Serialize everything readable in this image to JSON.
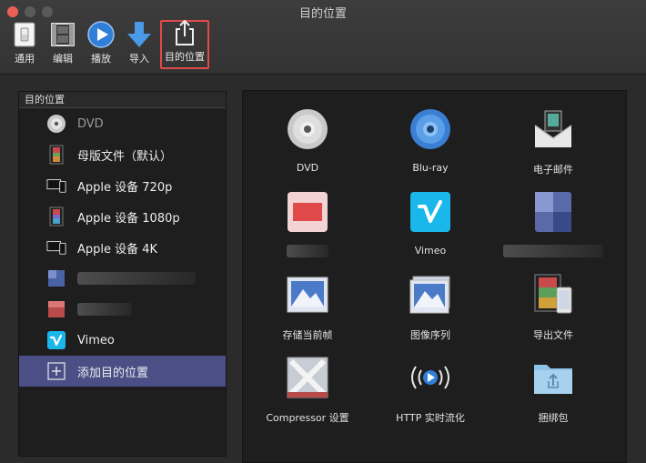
{
  "window": {
    "title": "目的位置"
  },
  "toolbar": {
    "items": [
      {
        "label": "通用"
      },
      {
        "label": "编辑"
      },
      {
        "label": "播放"
      },
      {
        "label": "导入"
      },
      {
        "label": "目的位置"
      }
    ]
  },
  "sidebar": {
    "header": "目的位置",
    "items": [
      {
        "label": "DVD",
        "icon": "dvd-disc-icon"
      },
      {
        "label": "母版文件（默认）",
        "icon": "film-strip-icon"
      },
      {
        "label": "Apple 设备 720p",
        "icon": "apple-devices-icon"
      },
      {
        "label": "Apple 设备 1080p",
        "icon": "film-strip-icon"
      },
      {
        "label": "Apple 设备 4K",
        "icon": "apple-devices-icon"
      },
      {
        "label": "",
        "icon": "blurred-icon"
      },
      {
        "label": "",
        "icon": "blurred-icon"
      },
      {
        "label": "Vimeo",
        "icon": "vimeo-icon"
      },
      {
        "label": "添加目的位置",
        "icon": "add-icon"
      }
    ]
  },
  "destinations": {
    "items": [
      {
        "label": "DVD",
        "icon": "dvd-disc-icon"
      },
      {
        "label": "Blu-ray",
        "icon": "bluray-disc-icon"
      },
      {
        "label": "电子邮件",
        "icon": "email-icon"
      },
      {
        "label": "",
        "icon": "blurred-icon"
      },
      {
        "label": "Vimeo",
        "icon": "vimeo-icon"
      },
      {
        "label": "",
        "icon": "blurred-icon"
      },
      {
        "label": "存储当前帧",
        "icon": "image-frame-icon"
      },
      {
        "label": "图像序列",
        "icon": "image-sequence-icon"
      },
      {
        "label": "导出文件",
        "icon": "export-file-icon"
      },
      {
        "label": "Compressor 设置",
        "icon": "compressor-icon"
      },
      {
        "label": "HTTP 实时流化",
        "icon": "http-live-stream-icon"
      },
      {
        "label": "捆绑包",
        "icon": "bundle-folder-icon"
      }
    ]
  },
  "colors": {
    "selected_row": "#4a4f86",
    "active_tool_border": "#e24a4a",
    "vimeo": "#1ab7ea"
  }
}
